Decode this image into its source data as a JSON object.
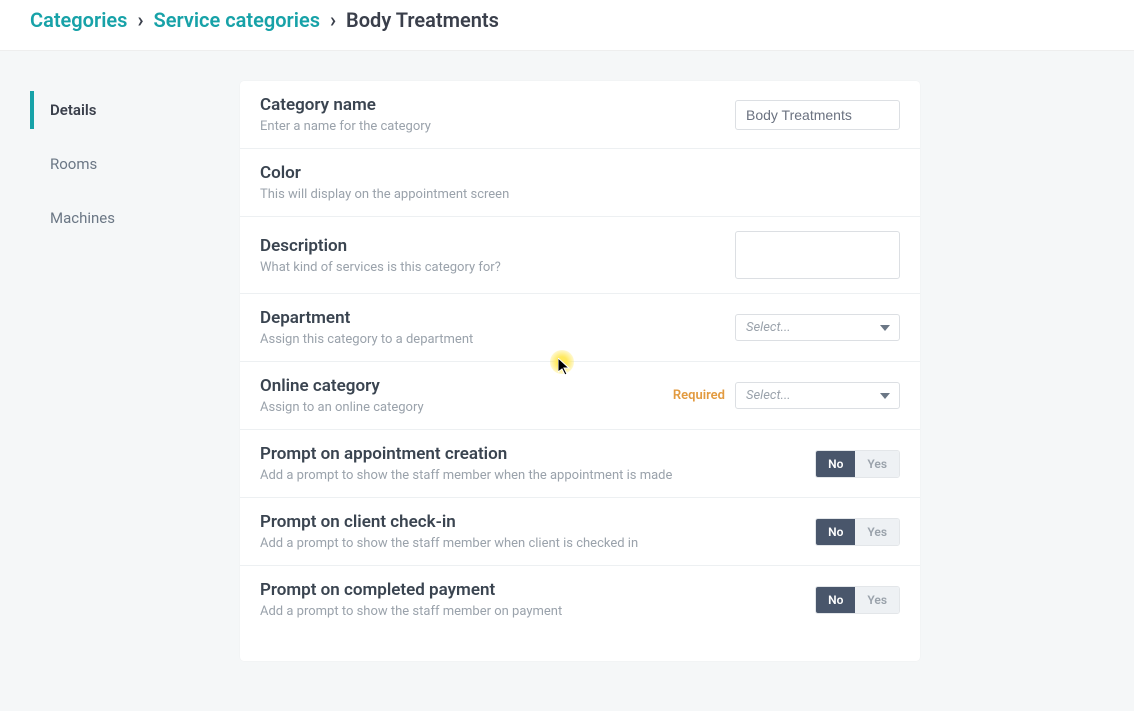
{
  "breadcrumb": {
    "level1": "Categories",
    "level2": "Service categories",
    "current": "Body Treatments"
  },
  "sidenav": {
    "items": [
      {
        "label": "Details",
        "active": true
      },
      {
        "label": "Rooms",
        "active": false
      },
      {
        "label": "Machines",
        "active": false
      }
    ]
  },
  "fields": {
    "category_name": {
      "label": "Category name",
      "hint": "Enter a name for the category",
      "value": "Body Treatments"
    },
    "color": {
      "label": "Color",
      "hint": "This will display on the appointment screen"
    },
    "description": {
      "label": "Description",
      "hint": "What kind of services is this category for?",
      "value": ""
    },
    "department": {
      "label": "Department",
      "hint": "Assign this category to a department",
      "placeholder": "Select..."
    },
    "online_category": {
      "label": "Online category",
      "hint": "Assign to an online category",
      "placeholder": "Select...",
      "required_tag": "Required"
    },
    "prompt_creation": {
      "label": "Prompt on appointment creation",
      "hint": "Add a prompt to show the staff member when the appointment is made",
      "no": "No",
      "yes": "Yes"
    },
    "prompt_checkin": {
      "label": "Prompt on client check-in",
      "hint": "Add a prompt to show the staff member when client is checked in",
      "no": "No",
      "yes": "Yes"
    },
    "prompt_payment": {
      "label": "Prompt on completed payment",
      "hint": "Add a prompt to show the staff member on payment",
      "no": "No",
      "yes": "Yes"
    }
  }
}
